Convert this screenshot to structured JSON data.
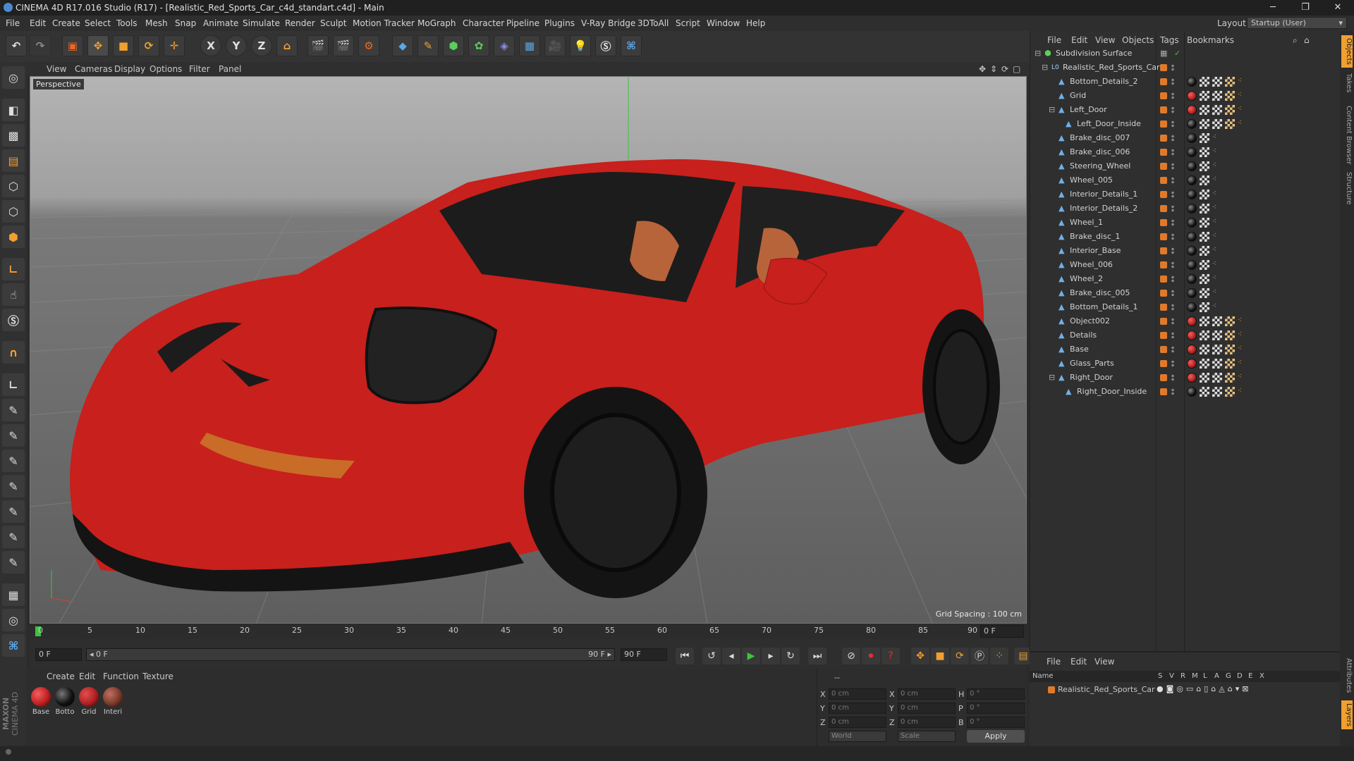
{
  "window": {
    "title": "CINEMA 4D R17.016 Studio (R17) - [Realistic_Red_Sports_Car_c4d_standart.c4d] - Main",
    "minimize": "─",
    "maximize": "❐",
    "close": "✕"
  },
  "menu": [
    "File",
    "Edit",
    "Create",
    "Select",
    "Tools",
    "Mesh",
    "Snap",
    "Animate",
    "Simulate",
    "Render",
    "Sculpt",
    "Motion Tracker",
    "MoGraph",
    "Character",
    "Pipeline",
    "Plugins",
    "V-Ray Bridge",
    "3DToAll",
    "Script",
    "Window",
    "Help"
  ],
  "layout": {
    "label": "Layout:",
    "value": "Startup (User)"
  },
  "toolbar": {
    "axis_x": "X",
    "axis_y": "Y",
    "axis_z": "Z"
  },
  "viewport": {
    "menu": [
      "View",
      "Cameras",
      "Display",
      "Options",
      "Filter",
      "Panel"
    ],
    "label": "Perspective",
    "grid_spacing": "Grid Spacing : 100 cm",
    "colors": {
      "car_body": "#c8201c",
      "car_dark": "#1a1a1a",
      "interior": "#b8643a"
    }
  },
  "timeline": {
    "ticks": [
      "0",
      "5",
      "10",
      "15",
      "20",
      "25",
      "30",
      "35",
      "40",
      "45",
      "50",
      "55",
      "60",
      "65",
      "70",
      "75",
      "80",
      "85",
      "90"
    ],
    "current_frame": "0 F",
    "start_field": "0 F",
    "range_start": "◂ 0 F",
    "range_end": "90 F ▸",
    "end_field": "90 F"
  },
  "materials": {
    "menu": [
      "Create",
      "Edit",
      "Function",
      "Texture"
    ],
    "items": [
      {
        "label": "Base",
        "color": "#c02020"
      },
      {
        "label": "Botto",
        "color": "#111111"
      },
      {
        "label": "Grid",
        "color": "#b02020"
      },
      {
        "label": "Interi",
        "color": "#7a3a2a"
      }
    ]
  },
  "coords": {
    "header": "--",
    "rows": [
      {
        "l1": "X",
        "v1": "0 cm",
        "l2": "X",
        "v2": "0 cm",
        "l3": "H",
        "v3": "0 °"
      },
      {
        "l1": "Y",
        "v1": "0 cm",
        "l2": "Y",
        "v2": "0 cm",
        "l3": "P",
        "v3": "0 °"
      },
      {
        "l1": "Z",
        "v1": "0 cm",
        "l2": "Z",
        "v2": "0 cm",
        "l3": "B",
        "v3": "0 °"
      }
    ],
    "world": "World",
    "scale": "Scale",
    "apply": "Apply"
  },
  "objects": {
    "menu": [
      "File",
      "Edit",
      "View",
      "Objects",
      "Tags",
      "Bookmarks"
    ],
    "items": [
      {
        "name": "Subdivision Surface",
        "indent": 0
      },
      {
        "name": "Realistic_Red_Sports_Car",
        "indent": 1
      },
      {
        "name": "Bottom_Details_2",
        "indent": 2
      },
      {
        "name": "Grid",
        "indent": 2
      },
      {
        "name": "Left_Door",
        "indent": 2
      },
      {
        "name": "Left_Door_Inside",
        "indent": 3
      },
      {
        "name": "Brake_disc_007",
        "indent": 2
      },
      {
        "name": "Brake_disc_006",
        "indent": 2
      },
      {
        "name": "Steering_Wheel",
        "indent": 2
      },
      {
        "name": "Wheel_005",
        "indent": 2
      },
      {
        "name": "Interior_Details_1",
        "indent": 2
      },
      {
        "name": "Interior_Details_2",
        "indent": 2
      },
      {
        "name": "Wheel_1",
        "indent": 2
      },
      {
        "name": "Brake_disc_1",
        "indent": 2
      },
      {
        "name": "Interior_Base",
        "indent": 2
      },
      {
        "name": "Wheel_006",
        "indent": 2
      },
      {
        "name": "Wheel_2",
        "indent": 2
      },
      {
        "name": "Brake_disc_005",
        "indent": 2
      },
      {
        "name": "Bottom_Details_1",
        "indent": 2
      },
      {
        "name": "Object002",
        "indent": 2
      },
      {
        "name": "Details",
        "indent": 2
      },
      {
        "name": "Base",
        "indent": 2
      },
      {
        "name": "Glass_Parts",
        "indent": 2
      },
      {
        "name": "Right_Door",
        "indent": 2
      },
      {
        "name": "Right_Door_Inside",
        "indent": 3
      }
    ]
  },
  "layers": {
    "menu": [
      "File",
      "Edit",
      "View"
    ],
    "cols": [
      "Name",
      "S",
      "V",
      "R",
      "M",
      "L",
      "A",
      "G",
      "D",
      "E",
      "X"
    ],
    "row": "Realistic_Red_Sports_Car"
  },
  "side_tabs": [
    "Objects",
    "Takes",
    "Content Browser",
    "Structure"
  ],
  "side_tabs_bottom": [
    "Attributes",
    "Layers"
  ],
  "brand": {
    "maxon": "MAXON",
    "c4d": "CINEMA 4D"
  }
}
